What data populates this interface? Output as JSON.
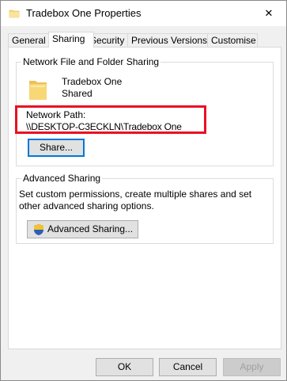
{
  "window": {
    "title": "Tradebox One Properties",
    "close_glyph": "✕"
  },
  "tabs": [
    {
      "label": "General"
    },
    {
      "label": "Sharing"
    },
    {
      "label": "Security"
    },
    {
      "label": "Previous Versions"
    },
    {
      "label": "Customise"
    }
  ],
  "network_sharing": {
    "group_label": "Network File and Folder Sharing",
    "folder_name": "Tradebox One",
    "status": "Shared",
    "path_label": "Network Path:",
    "path_value": "\\\\DESKTOP-C3ECKLN\\Tradebox One",
    "share_button": "Share..."
  },
  "advanced_sharing": {
    "group_label": "Advanced Sharing",
    "description": "Set custom permissions, create multiple shares and set other advanced sharing options.",
    "button_label": "Advanced Sharing..."
  },
  "footer": {
    "ok": "OK",
    "cancel": "Cancel",
    "apply": "Apply"
  },
  "colors": {
    "highlight": "#e81123",
    "focus_border": "#0078d7",
    "folder_yellow": "#f8d775"
  },
  "icons": {
    "title": "folder-icon",
    "close": "close-icon",
    "folder": "folder-icon",
    "advanced_button": "uac-shield-icon"
  }
}
